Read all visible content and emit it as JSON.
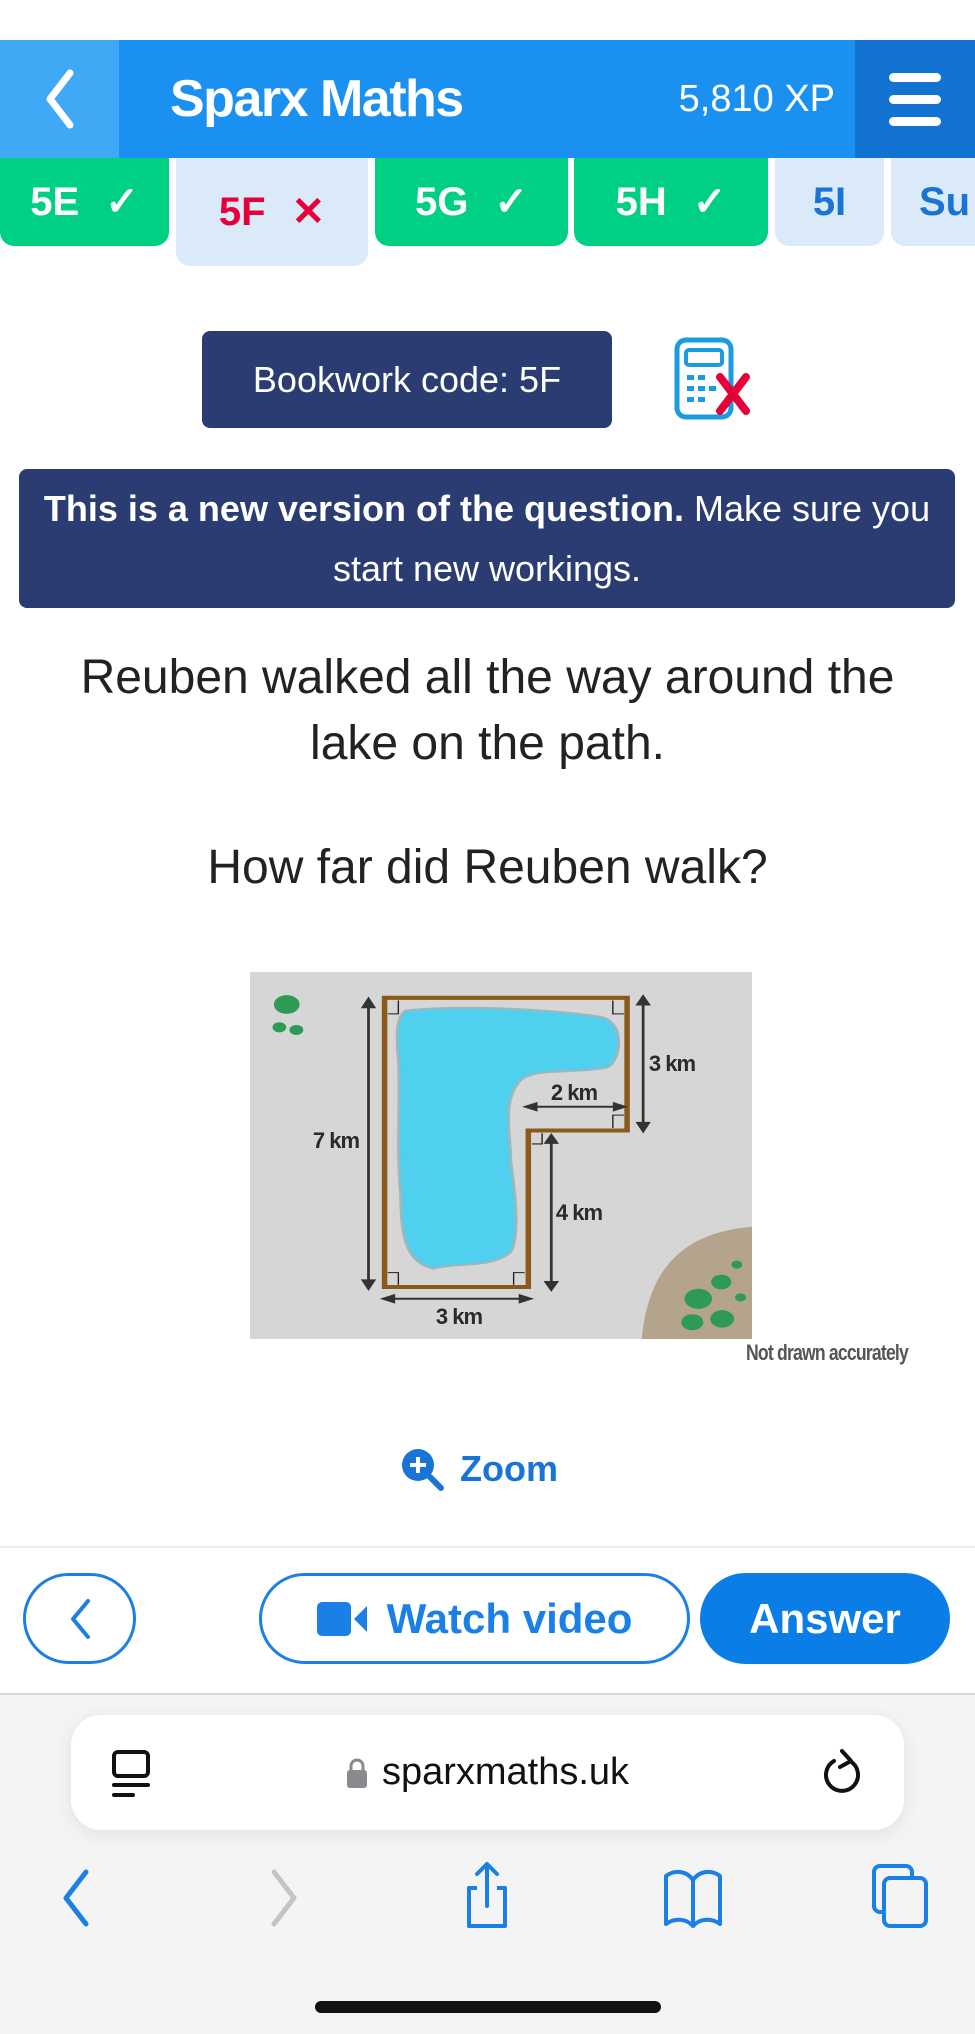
{
  "header": {
    "title": "Sparx Maths",
    "xp": "5,810 XP"
  },
  "tabs": [
    {
      "label": "5E",
      "status": "correct"
    },
    {
      "label": "5F",
      "status": "incorrect"
    },
    {
      "label": "5G",
      "status": "correct"
    },
    {
      "label": "5H",
      "status": "correct"
    },
    {
      "label": "5I",
      "status": "pending"
    },
    {
      "label": "Su",
      "status": "pending"
    }
  ],
  "bookwork": {
    "label": "Bookwork code: 5F",
    "calculator": "calculator-not-allowed-icon"
  },
  "notice": {
    "bold": "This is a new version of the question.",
    "rest": " Make sure you start new workings."
  },
  "question": {
    "line1": "Reuben walked all the way around the",
    "line2": "lake on the path.",
    "prompt": "How far did Reuben walk?"
  },
  "diagram": {
    "labels": {
      "left": "7 km",
      "top_right": "3 km",
      "inner_horizontal": "2 km",
      "inner_vertical": "4 km",
      "bottom": "3 km"
    },
    "note": "Not drawn accurately"
  },
  "zoom_label": "Zoom",
  "buttons": {
    "watch_video": "Watch video",
    "answer": "Answer"
  },
  "browser": {
    "url": "sparxmaths.uk"
  },
  "colors": {
    "header": "#1a90f0",
    "correct": "#00d084",
    "incorrect": "#e5003a",
    "navy": "#2b3c73",
    "accent": "#0a7de6"
  }
}
